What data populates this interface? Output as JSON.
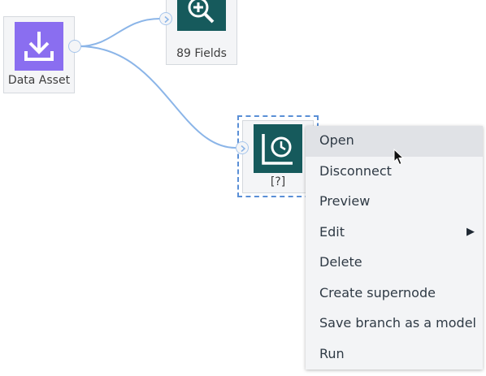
{
  "canvas": {
    "nodes": {
      "data_asset": {
        "label": "Data Asset",
        "icon": "import-download-icon",
        "color": "#8a6ef0"
      },
      "fields": {
        "label": "89 Fields",
        "icon": "magnifier-plus-icon",
        "color": "#165a5c"
      },
      "unknown": {
        "label": "[?]",
        "icon": "chart-gauge-icon",
        "color": "#165a5c"
      }
    }
  },
  "context_menu": {
    "items": [
      {
        "label": "Open"
      },
      {
        "label": "Disconnect"
      },
      {
        "label": "Preview"
      },
      {
        "label": "Edit"
      },
      {
        "label": "Delete"
      },
      {
        "label": "Create supernode"
      },
      {
        "label": "Save branch as a model"
      },
      {
        "label": "Run"
      }
    ],
    "submenu_arrow": "▶"
  },
  "colors": {
    "link": "#8bb5e8",
    "selection": "#5a8fd6",
    "menu_bg": "#f3f4f6",
    "menu_hover": "#e0e2e6"
  }
}
